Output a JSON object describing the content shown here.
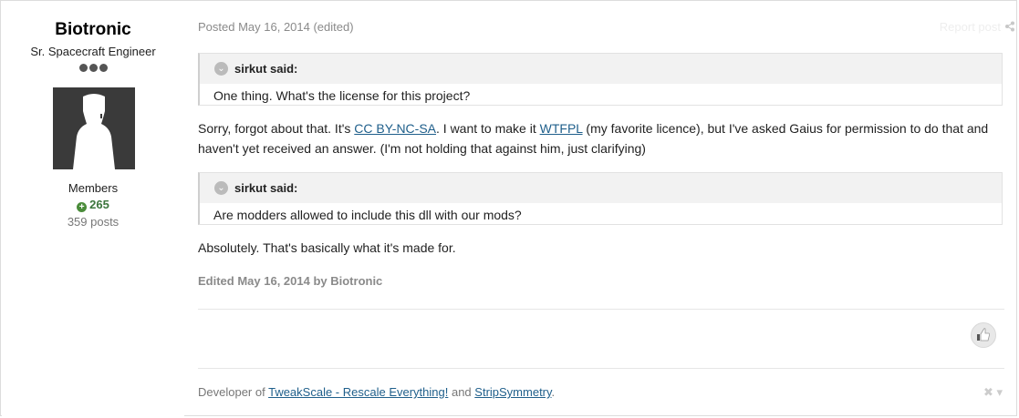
{
  "author": {
    "name": "Biotronic",
    "title": "Sr. Spacecraft Engineer",
    "group": "Members",
    "reputation": "265",
    "posts": "359 posts"
  },
  "post": {
    "meta": "Posted May 16, 2014 (edited)",
    "report_label": "Report post",
    "quote1": {
      "citation": "sirkut said:",
      "text": "One thing. What's the license for this project?"
    },
    "para1": {
      "t1": "Sorry, forgot about that. It's ",
      "link1": "CC BY-NC-SA",
      "t2": ". I want to make it ",
      "link2": "WTFPL",
      "t3": " (my favorite licence), but I've asked Gaius for permission to do that and",
      "line2": "haven't yet received an answer. (I'm not holding that against him, just clarifying)"
    },
    "quote2": {
      "citation": "sirkut said:",
      "text": "Are modders allowed to include this dll with our mods?"
    },
    "para2": "Absolutely. That's basically what it's made for.",
    "edited": "Edited May 16, 2014 by Biotronic"
  },
  "signature": {
    "prefix": "Developer of ",
    "link1": "TweakScale - Rescale Everything!",
    "mid": " and ",
    "link2": "StripSymmetry",
    "suffix": "."
  },
  "icons": {
    "rep": "plus-circle-icon",
    "share": "share-icon",
    "like": "thumbs-up-icon",
    "close": "close-icon",
    "quote_toggle": "chevron-circle-icon"
  }
}
